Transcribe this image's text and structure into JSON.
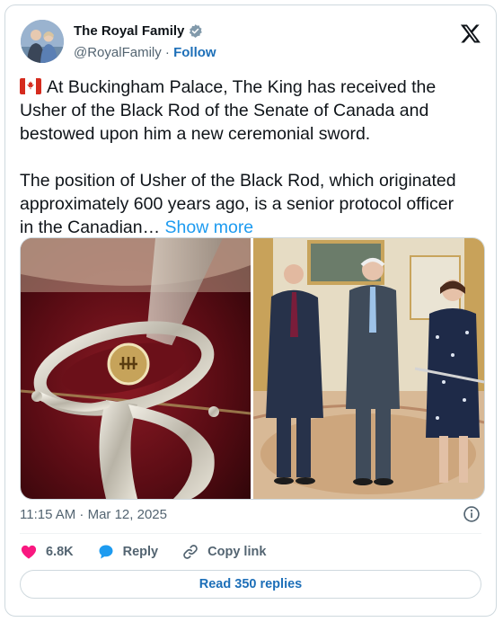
{
  "author": {
    "display_name": "The Royal Family",
    "handle": "@RoyalFamily",
    "separator": "·",
    "follow_label": "Follow"
  },
  "tweet": {
    "line1": "At Buckingham Palace, The King has received the",
    "line2": "Usher of the Black Rod of the Senate of Canada and",
    "line3": "bestowed upon him a new ceremonial sword.",
    "line5": "The position of Usher of the Black Rod, which originated",
    "line6": "approximately 600 years ago, is a senior protocol officer",
    "line7": "in the Canadian…",
    "show_more": "Show more"
  },
  "meta": {
    "timestamp": "11:15 AM · Mar 12, 2025"
  },
  "actions": {
    "likes": "6.8K",
    "reply_label": "Reply",
    "copy_label": "Copy link"
  },
  "read_replies_label": "Read 350 replies",
  "colors": {
    "like": "#f91880",
    "reply": "#1d9bf0",
    "verified": "#829aab",
    "link": "#1d9bf0"
  },
  "icons": [
    "x-logo-icon",
    "verified-badge-icon",
    "canada-flag-icon",
    "info-icon",
    "heart-icon",
    "reply-bubble-icon",
    "link-icon"
  ]
}
